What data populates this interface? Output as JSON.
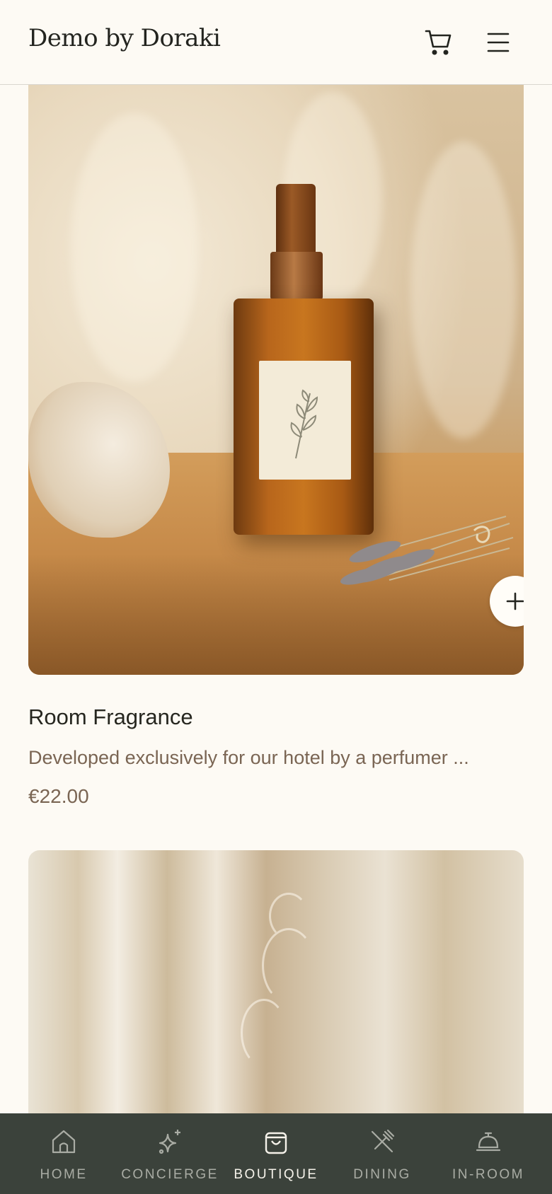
{
  "header": {
    "brand": "Demo by Doraki",
    "cart_icon": "cart-icon",
    "menu_icon": "hamburger-menu-icon"
  },
  "products": [
    {
      "title": "Room Fragrance",
      "description": "Developed exclusively for our hotel by a perfumer ...",
      "price": "€22.00",
      "add_icon": "plus-icon"
    }
  ],
  "bottom_nav": {
    "items": [
      {
        "label": "HOME",
        "icon": "home-icon"
      },
      {
        "label": "CONCIERGE",
        "icon": "sparkle-icon"
      },
      {
        "label": "BOUTIQUE",
        "icon": "shopping-bag-icon",
        "active": true
      },
      {
        "label": "DINING",
        "icon": "utensils-icon"
      },
      {
        "label": "IN-ROOM",
        "icon": "service-bell-icon"
      }
    ]
  },
  "colors": {
    "background": "#fdfaf4",
    "nav_background": "#3b423b",
    "muted_text": "#7a6553"
  }
}
